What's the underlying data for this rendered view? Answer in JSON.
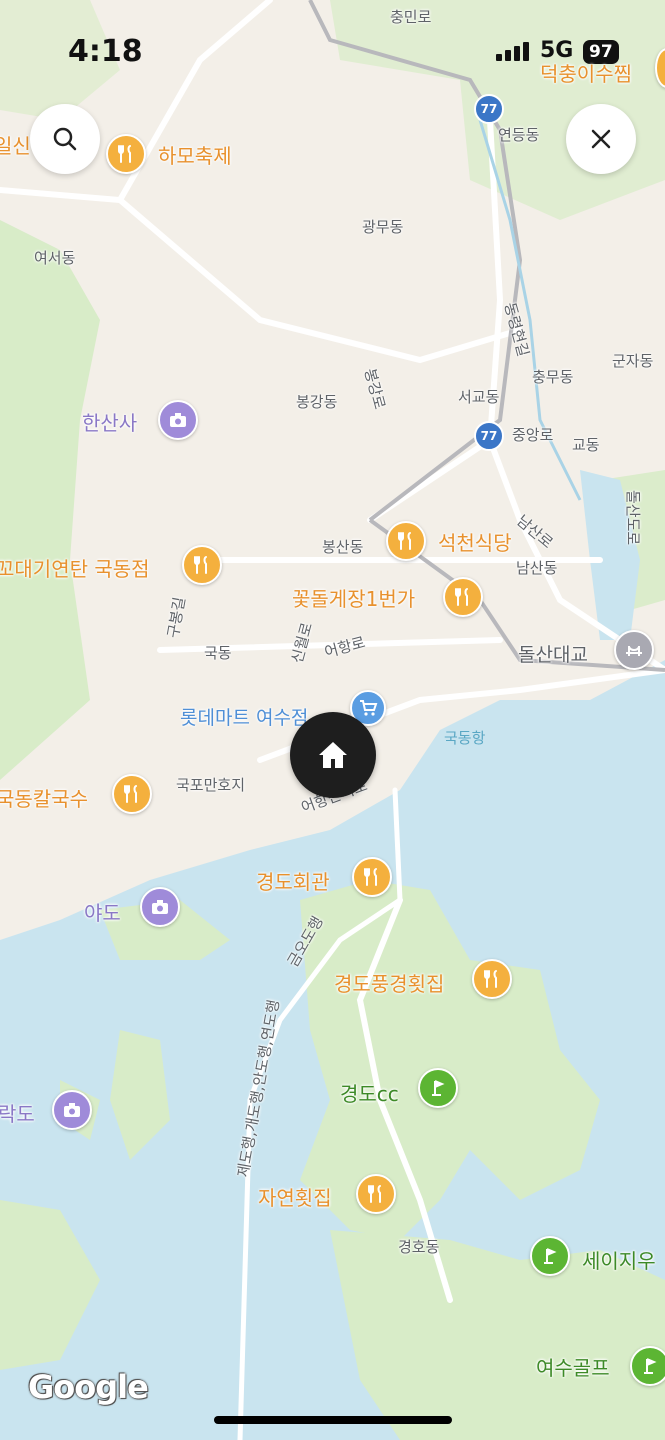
{
  "status_bar": {
    "time": "4:18",
    "network": "5G",
    "battery": "97"
  },
  "map": {
    "colors": {
      "water": "#c9e4ef",
      "land": "#f3efe8",
      "park": "#d8ecc8",
      "road": "#ffffff",
      "route": "#3b76c7"
    },
    "route_shields": [
      "77",
      "77"
    ],
    "area_labels": [
      "충민로",
      "연등동",
      "광무동",
      "여서동",
      "동령현길",
      "군자동",
      "충무동",
      "봉강동",
      "봉강로",
      "서교동",
      "중앙로",
      "교동",
      "남산로",
      "봉산동",
      "남산동",
      "국동",
      "구봉길",
      "신월로",
      "어항로",
      "어항단지로",
      "국포만호지",
      "국동항",
      "금오도행",
      "돌산도로",
      "경호동",
      "제도행,개도행,안도행,연도행"
    ],
    "food_places": [
      "하모축제",
      "석천식당",
      "꽃돌게장1번가",
      "꼬대기연탄 국동점",
      "국동칼국수",
      "경도회관",
      "경도풍경횟집",
      "자연횟집",
      "일신",
      "덕충이수찜"
    ],
    "attractions": [
      "한산사",
      "야도",
      "락도"
    ],
    "shop": "롯데마트 여수점",
    "bridge": "돌산대교",
    "golf": [
      "경도cc",
      "세이지우",
      "여수골프"
    ]
  },
  "controls": {
    "search": "search-icon",
    "close": "close-icon",
    "home": "home-icon"
  },
  "attribution": "Google"
}
